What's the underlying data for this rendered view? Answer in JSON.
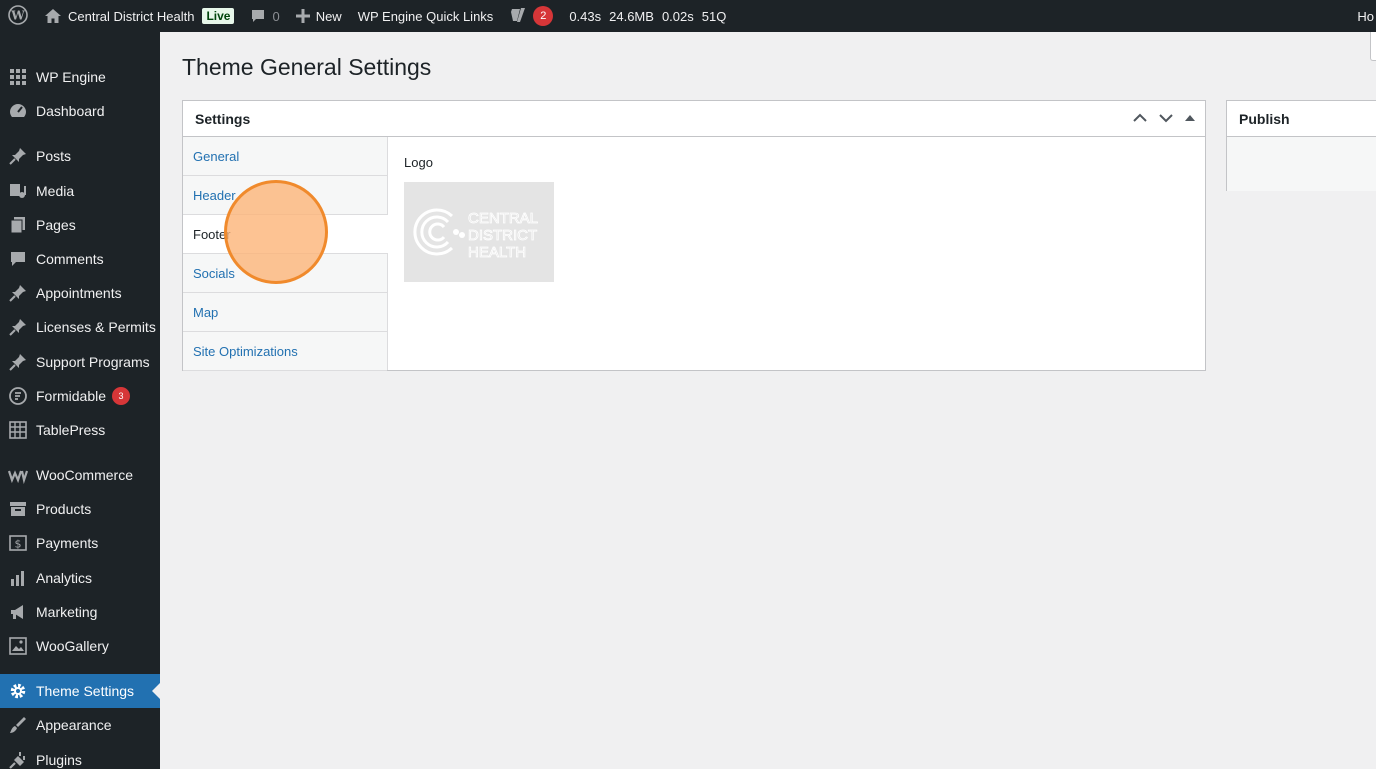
{
  "adminbar": {
    "site_name": "Central District Health",
    "live_label": "Live",
    "comments_count": "0",
    "new_label": "New",
    "quick_links": "WP Engine Quick Links",
    "yoast_count": "2",
    "qm_time": "0.43s",
    "qm_memory": "24.6MB",
    "qm_db_time": "0.02s",
    "qm_queries": "51Q",
    "howdy": "Ho"
  },
  "sidebar": {
    "items": [
      {
        "label": "WP Engine",
        "icon": "grid-icon"
      },
      {
        "label": "Dashboard",
        "icon": "dashboard-icon"
      },
      {
        "label": "Posts",
        "icon": "pin-icon"
      },
      {
        "label": "Media",
        "icon": "media-icon"
      },
      {
        "label": "Pages",
        "icon": "pages-icon"
      },
      {
        "label": "Comments",
        "icon": "comment-icon"
      },
      {
        "label": "Appointments",
        "icon": "pin-icon"
      },
      {
        "label": "Licenses & Permits",
        "icon": "pin-icon"
      },
      {
        "label": "Support Programs",
        "icon": "pin-icon"
      },
      {
        "label": "Formidable",
        "icon": "formidable-icon",
        "badge": "3"
      },
      {
        "label": "TablePress",
        "icon": "table-icon"
      },
      {
        "label": "WooCommerce",
        "icon": "woo-icon"
      },
      {
        "label": "Products",
        "icon": "archive-icon"
      },
      {
        "label": "Payments",
        "icon": "dollar-icon"
      },
      {
        "label": "Analytics",
        "icon": "bar-chart-icon"
      },
      {
        "label": "Marketing",
        "icon": "megaphone-icon"
      },
      {
        "label": "WooGallery",
        "icon": "gallery-icon"
      },
      {
        "label": "Theme Settings",
        "icon": "gear-icon",
        "current": true
      },
      {
        "label": "Appearance",
        "icon": "brush-icon"
      },
      {
        "label": "Plugins",
        "icon": "plug-icon"
      }
    ]
  },
  "main": {
    "title": "Theme General Settings",
    "settings_box": {
      "title": "Settings",
      "tabs": [
        "General",
        "Header",
        "Footer",
        "Socials",
        "Map",
        "Site Optimizations"
      ],
      "active_tab": "Footer",
      "field_label": "Logo",
      "logo_text": [
        "CENTRAL",
        "DISTRICT",
        "HEALTH"
      ]
    },
    "publish_box": {
      "title": "Publish"
    }
  },
  "colors": {
    "adminbar_bg": "#1d2327",
    "accent": "#2271b1",
    "badge_red": "#d63638",
    "click_indicator": "#f08a2c"
  }
}
